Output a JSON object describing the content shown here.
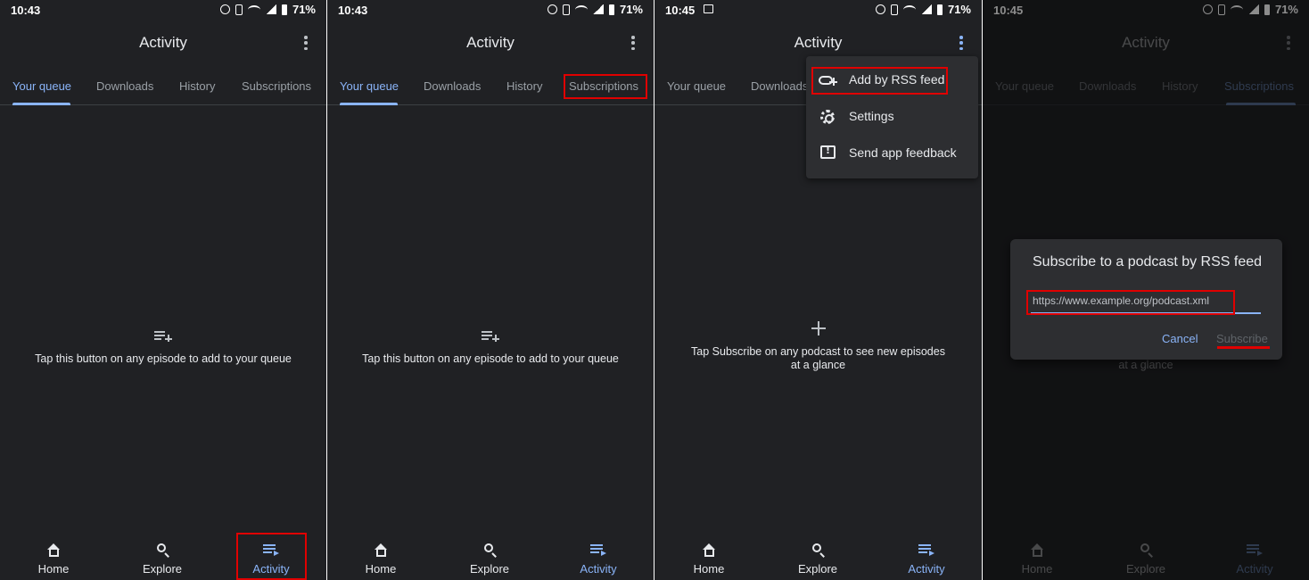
{
  "status": {
    "time_a": "10:43",
    "time_b": "10:45",
    "battery": "71%"
  },
  "appbar": {
    "title": "Activity"
  },
  "tabs": {
    "queue": "Your queue",
    "downloads": "Downloads",
    "history": "History",
    "subscriptions": "Subscriptions"
  },
  "empty": {
    "queue": "Tap this button on any episode to add to your queue",
    "subs_line1": "Tap Subscribe on any podcast to see new episodes",
    "subs_line2": "at a glance"
  },
  "nav": {
    "home": "Home",
    "explore": "Explore",
    "activity": "Activity"
  },
  "menu": {
    "rss": "Add by RSS feed",
    "settings": "Settings",
    "feedback": "Send app feedback"
  },
  "dialog": {
    "title": "Subscribe to a podcast by RSS feed",
    "input_value": "https://www.example.org/podcast.xml",
    "cancel": "Cancel",
    "subscribe": "Subscribe"
  },
  "colors": {
    "accent": "#8ab4f8",
    "background": "#202124",
    "highlight": "#e00000"
  },
  "icons": [
    "more-vert-icon",
    "queue-add-icon",
    "plus-icon",
    "home-icon",
    "search-icon",
    "activity-icon",
    "rss-add-icon",
    "gear-icon",
    "feedback-icon"
  ]
}
